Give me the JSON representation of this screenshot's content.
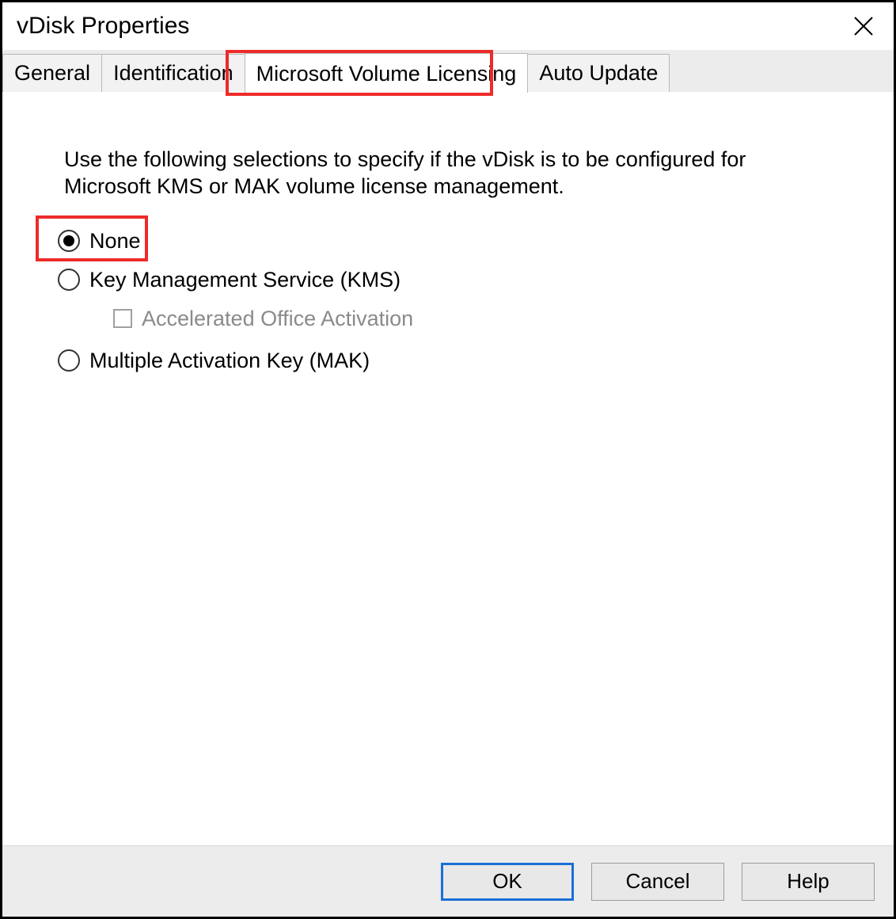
{
  "window": {
    "title": "vDisk Properties"
  },
  "tabs": {
    "general": "General",
    "identification": "Identification",
    "licensing": "Microsoft Volume Licensing",
    "autoupdate": "Auto Update"
  },
  "body": {
    "description": "Use the following selections to specify if the vDisk is to be configured for Microsoft KMS or MAK volume license management.",
    "option_none": "None",
    "option_kms": "Key Management Service (KMS)",
    "sub_accel": "Accelerated Office Activation",
    "option_mak": "Multiple Activation Key (MAK)"
  },
  "buttons": {
    "ok": "OK",
    "cancel": "Cancel",
    "help": "Help"
  }
}
